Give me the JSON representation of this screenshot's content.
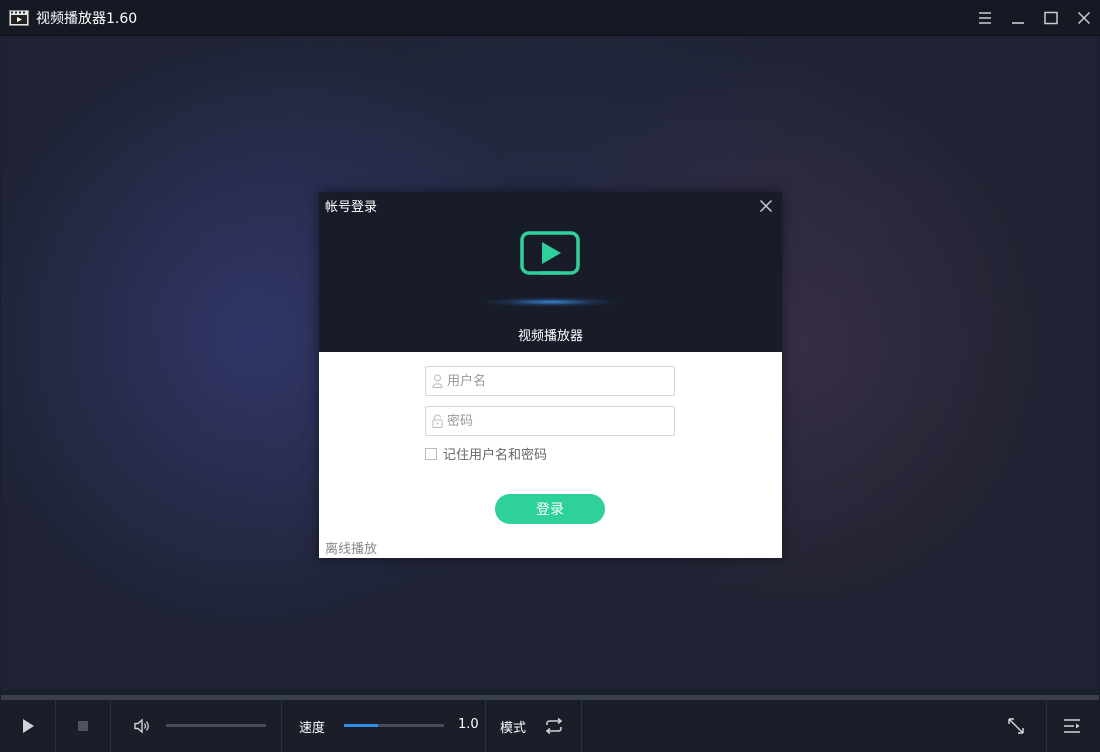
{
  "window": {
    "title": "视频播放器1.60",
    "controls": [
      "menu-icon",
      "minimize-icon",
      "maximize-icon",
      "close-icon"
    ]
  },
  "dialog": {
    "title": "帐号登录",
    "app_name": "视频播放器",
    "username_placeholder": "用户名",
    "password_placeholder": "密码",
    "remember_label": "记住用户名和密码",
    "remember_checked": false,
    "login_label": "登录",
    "offline_label": "离线播放",
    "accent_color": "#2ed199"
  },
  "controls": {
    "speed_label": "速度",
    "speed_value": "1.0",
    "speed_fill_fraction": 0.34,
    "volume_fraction": 0,
    "mode_label": "模式",
    "playback_progress": 0,
    "icons": [
      "play-icon",
      "stop-icon",
      "volume-icon",
      "loop-mode-icon",
      "fullscreen-icon",
      "playlist-icon"
    ]
  }
}
